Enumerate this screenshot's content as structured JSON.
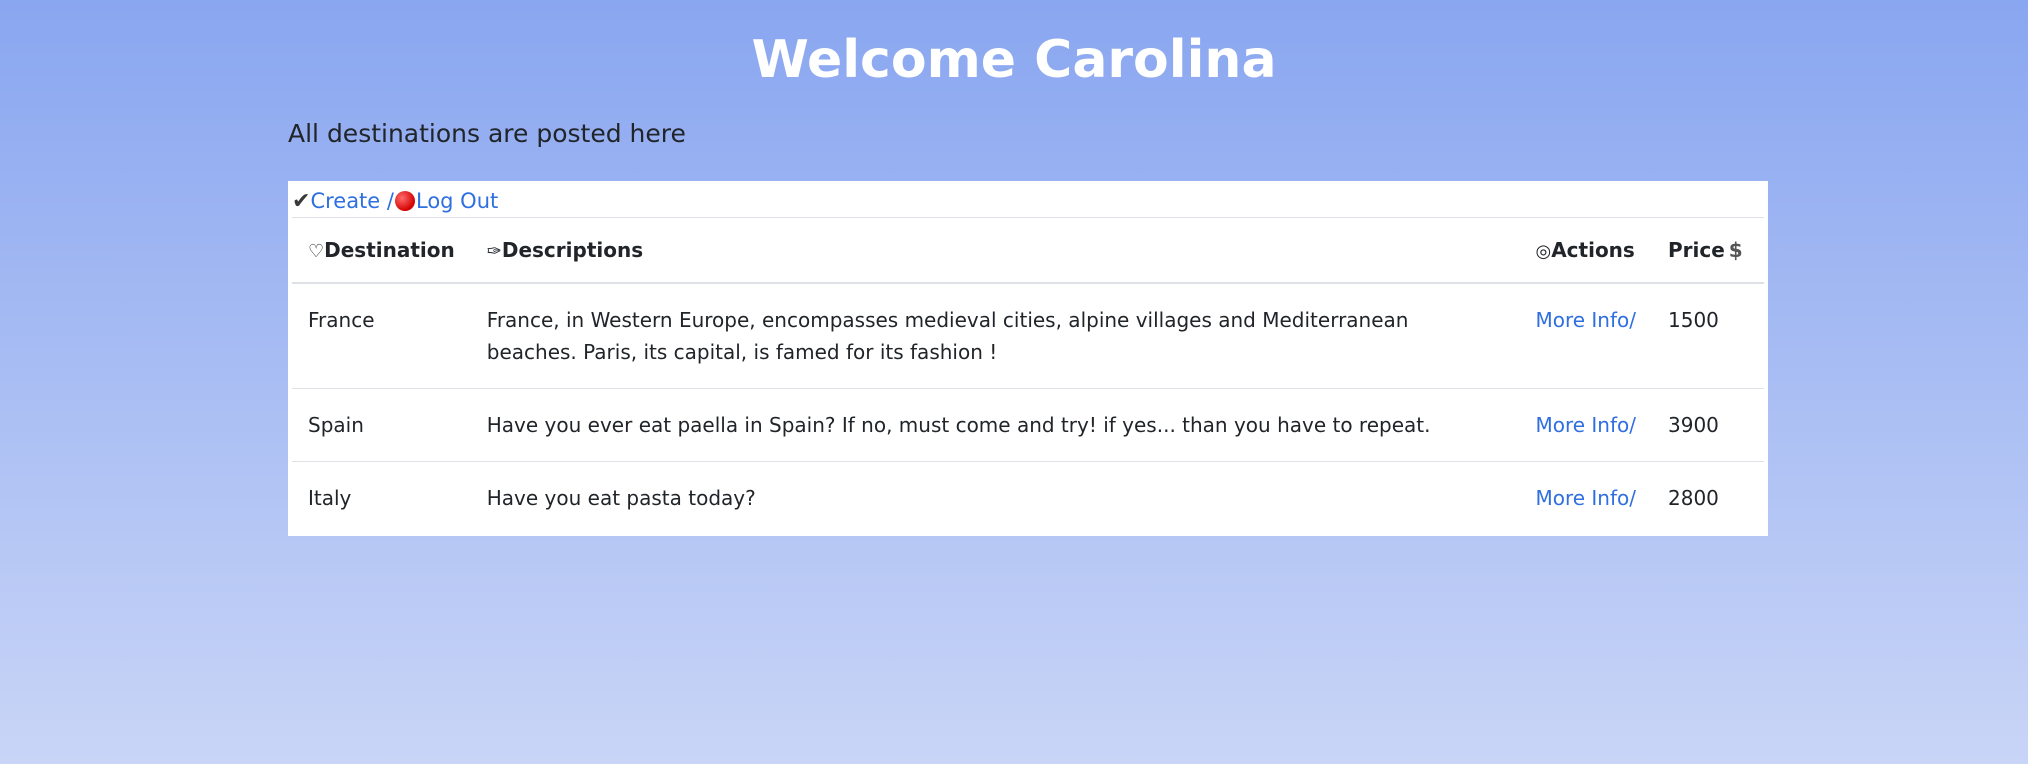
{
  "header": {
    "title": "Welcome Carolina",
    "subtitle": "All destinations are posted here"
  },
  "toolbar": {
    "check_glyph": "✔",
    "create_label": "Create",
    "separator": "/",
    "logout_label": "Log Out"
  },
  "table": {
    "headers": {
      "destination": {
        "icon": "♡",
        "label": "Destination"
      },
      "descriptions": {
        "icon": "✑",
        "label": "Descriptions"
      },
      "actions": {
        "icon": "◎",
        "label": "Actions"
      },
      "price": {
        "label": "Price",
        "icon": "$"
      }
    },
    "rows": [
      {
        "destination": "France",
        "description": "France, in Western Europe, encompasses medieval cities, alpine villages and Mediterranean beaches. Paris, its capital, is famed for its fashion !",
        "action": "More Info/",
        "price": "1500"
      },
      {
        "destination": "Spain",
        "description": "Have you ever eat paella in Spain? If no, must come and try! if yes... than you have to repeat.",
        "action": "More Info/",
        "price": "3900"
      },
      {
        "destination": "Italy",
        "description": "Have you eat pasta today?",
        "action": "More Info/",
        "price": "2800"
      }
    ]
  }
}
